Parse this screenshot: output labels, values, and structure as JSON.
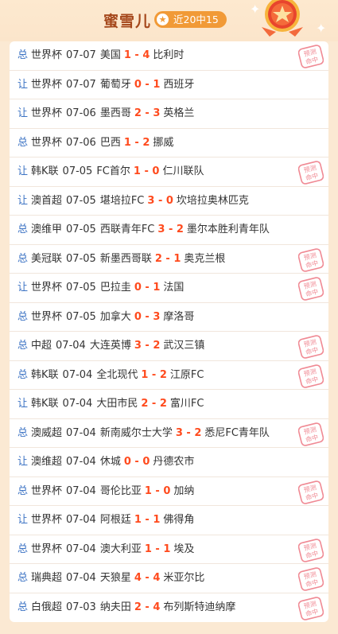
{
  "header": {
    "title": "蜜雪儿",
    "record": "近20中15"
  },
  "stamp_text": [
    "预测",
    "命中"
  ],
  "matches": [
    {
      "tag": "总",
      "league": "世界杯",
      "date": "07-07",
      "home": "美国",
      "hs": "1",
      "as": "4",
      "away": "比利时",
      "hit": true
    },
    {
      "tag": "让",
      "league": "世界杯",
      "date": "07-07",
      "home": "葡萄牙",
      "hs": "0",
      "as": "1",
      "away": "西班牙",
      "hit": false
    },
    {
      "tag": "让",
      "league": "世界杯",
      "date": "07-06",
      "home": "墨西哥",
      "hs": "2",
      "as": "3",
      "away": "英格兰",
      "hit": false
    },
    {
      "tag": "总",
      "league": "世界杯",
      "date": "07-06",
      "home": "巴西",
      "hs": "1",
      "as": "2",
      "away": "挪威",
      "hit": false
    },
    {
      "tag": "让",
      "league": "韩K联",
      "date": "07-05",
      "home": "FC首尔",
      "hs": "1",
      "as": "0",
      "away": "仁川联队",
      "hit": true
    },
    {
      "tag": "让",
      "league": "澳首超",
      "date": "07-05",
      "home": "堪培拉FC",
      "hs": "3",
      "as": "0",
      "away": "坎培拉奥林匹克",
      "hit": false
    },
    {
      "tag": "总",
      "league": "澳维甲",
      "date": "07-05",
      "home": "西联青年FC",
      "hs": "3",
      "as": "2",
      "away": "墨尔本胜利青年队",
      "hit": false
    },
    {
      "tag": "总",
      "league": "美冠联",
      "date": "07-05",
      "home": "新墨西哥联",
      "hs": "2",
      "as": "1",
      "away": "奥克兰根",
      "hit": true
    },
    {
      "tag": "让",
      "league": "世界杯",
      "date": "07-05",
      "home": "巴拉圭",
      "hs": "0",
      "as": "1",
      "away": "法国",
      "hit": true
    },
    {
      "tag": "总",
      "league": "世界杯",
      "date": "07-05",
      "home": "加拿大",
      "hs": "0",
      "as": "3",
      "away": "摩洛哥",
      "hit": false
    },
    {
      "tag": "总",
      "league": "中超",
      "date": "07-04",
      "home": "大连英博",
      "hs": "3",
      "as": "2",
      "away": "武汉三镇",
      "hit": true
    },
    {
      "tag": "总",
      "league": "韩K联",
      "date": "07-04",
      "home": "全北现代",
      "hs": "1",
      "as": "2",
      "away": "江原FC",
      "hit": true
    },
    {
      "tag": "让",
      "league": "韩K联",
      "date": "07-04",
      "home": "大田市民",
      "hs": "2",
      "as": "2",
      "away": "富川FC",
      "hit": false
    },
    {
      "tag": "总",
      "league": "澳威超",
      "date": "07-04",
      "home": "新南威尔士大学",
      "hs": "3",
      "as": "2",
      "away": "悉尼FC青年队",
      "hit": true
    },
    {
      "tag": "让",
      "league": "澳维超",
      "date": "07-04",
      "home": "休城",
      "hs": "0",
      "as": "0",
      "away": "丹德农市",
      "hit": false
    },
    {
      "tag": "总",
      "league": "世界杯",
      "date": "07-04",
      "home": "哥伦比亚",
      "hs": "1",
      "as": "0",
      "away": "加纳",
      "hit": true
    },
    {
      "tag": "让",
      "league": "世界杯",
      "date": "07-04",
      "home": "阿根廷",
      "hs": "1",
      "as": "1",
      "away": "佛得角",
      "hit": false
    },
    {
      "tag": "总",
      "league": "世界杯",
      "date": "07-04",
      "home": "澳大利亚",
      "hs": "1",
      "as": "1",
      "away": "埃及",
      "hit": true
    },
    {
      "tag": "总",
      "league": "瑞典超",
      "date": "07-04",
      "home": "天狼星",
      "hs": "4",
      "as": "4",
      "away": "米亚尔比",
      "hit": true
    },
    {
      "tag": "总",
      "league": "白俄超",
      "date": "07-03",
      "home": "纳夫田",
      "hs": "2",
      "as": "4",
      "away": "布列斯特迪纳摩",
      "hit": true
    }
  ]
}
